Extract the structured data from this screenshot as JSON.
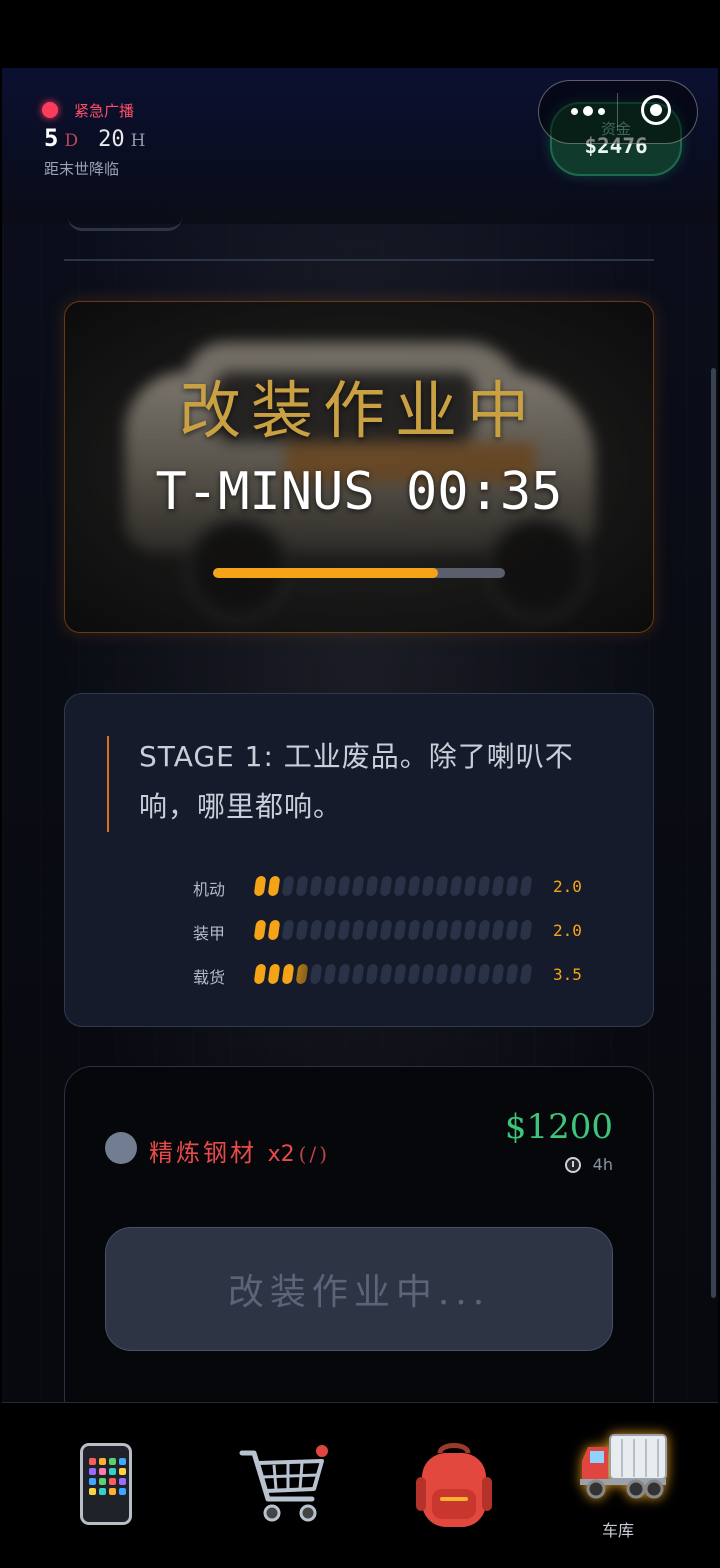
{
  "header": {
    "alert_label": "紧急广播",
    "countdown_days": "5",
    "countdown_day_unit": "D",
    "countdown_hours": "20",
    "countdown_hour_unit": "H",
    "doom_label": "距末世降临",
    "funds_label": "资金",
    "funds_value": "$2476"
  },
  "work": {
    "title": "改装作业中",
    "timer": "T-MINUS 00:35",
    "progress": 0.77
  },
  "stage": {
    "description": "STAGE 1: 工业废品。除了喇叭不响，哪里都响。",
    "stats": [
      {
        "label": "机动",
        "value": "2.0",
        "level": 2.0
      },
      {
        "label": "装甲",
        "value": "2.0",
        "level": 2.0
      },
      {
        "label": "载货",
        "value": "3.5",
        "level": 3.5
      }
    ],
    "max_level": 20
  },
  "cost": {
    "material_name": "精炼钢材",
    "material_qty": "x2",
    "material_note": "(/)",
    "price": "$1200",
    "time": "4h",
    "action_label": "改装作业中..."
  },
  "nav": {
    "items": [
      {
        "id": "phone",
        "label": ""
      },
      {
        "id": "shop",
        "label": ""
      },
      {
        "id": "backpack",
        "label": ""
      },
      {
        "id": "garage",
        "label": "车库",
        "active": true
      }
    ]
  },
  "colors": {
    "accent": "#f5a418",
    "alert": "#ff3b5c",
    "money": "#3ec57a",
    "title_gold": "#c9a042"
  }
}
